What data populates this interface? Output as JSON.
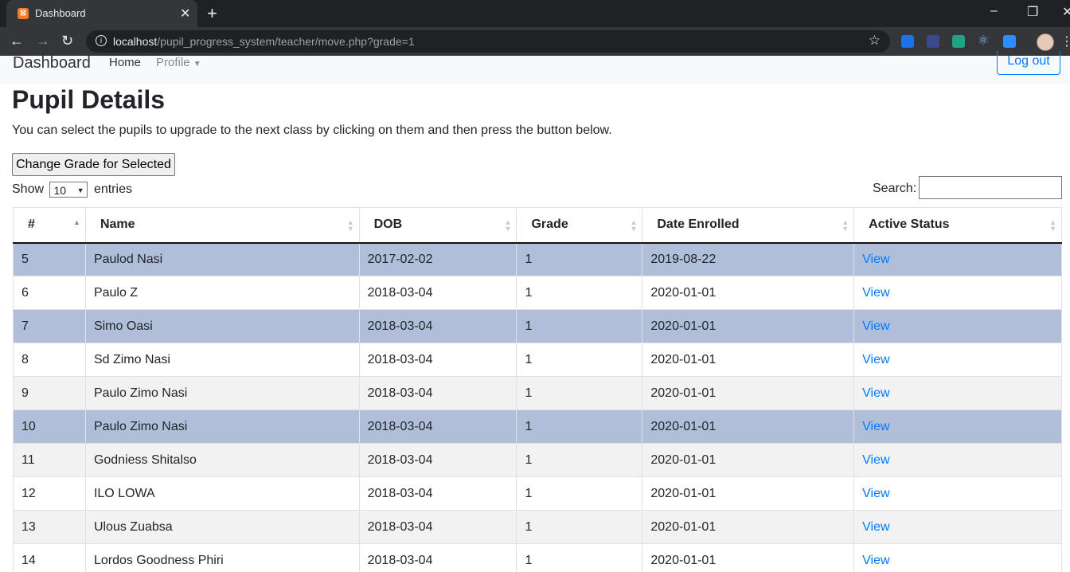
{
  "browser": {
    "tab_title": "Dashboard",
    "tab_favicon": "⊠",
    "url_host": "localhost",
    "url_path": "/pupil_progress_system/teacher/move.php?grade=1"
  },
  "navbar": {
    "brand": "Dashboard",
    "home": "Home",
    "profile": "Profile",
    "logout": "Log out"
  },
  "page": {
    "title": "Pupil Details",
    "intro": "You can select the pupils to upgrade to the next class by clicking on them and then press the button below.",
    "change_button": "Change Grade for Selected",
    "show_label": "Show",
    "show_value": "10",
    "entries_label": "entries",
    "search_label": "Search:"
  },
  "table": {
    "headers": [
      "#",
      "Name",
      "DOB",
      "Grade",
      "Date Enrolled",
      "Active Status"
    ],
    "rows": [
      {
        "id": "5",
        "name": "Paulod Nasi",
        "dob": "2017-02-02",
        "grade": "1",
        "enrolled": "2019-08-22",
        "status": "View"
      },
      {
        "id": "6",
        "name": "Paulo Z",
        "dob": "2018-03-04",
        "grade": "1",
        "enrolled": "2020-01-01",
        "status": "View"
      },
      {
        "id": "7",
        "name": "Simo Oasi",
        "dob": "2018-03-04",
        "grade": "1",
        "enrolled": "2020-01-01",
        "status": "View"
      },
      {
        "id": "8",
        "name": "Sd Zimo Nasi",
        "dob": "2018-03-04",
        "grade": "1",
        "enrolled": "2020-01-01",
        "status": "View"
      },
      {
        "id": "9",
        "name": "Paulo Zimo Nasi",
        "dob": "2018-03-04",
        "grade": "1",
        "enrolled": "2020-01-01",
        "status": "View"
      },
      {
        "id": "10",
        "name": "Paulo Zimo Nasi",
        "dob": "2018-03-04",
        "grade": "1",
        "enrolled": "2020-01-01",
        "status": "View"
      },
      {
        "id": "11",
        "name": "Godniess Shitalso",
        "dob": "2018-03-04",
        "grade": "1",
        "enrolled": "2020-01-01",
        "status": "View"
      },
      {
        "id": "12",
        "name": "ILO LOWA",
        "dob": "2018-03-04",
        "grade": "1",
        "enrolled": "2020-01-01",
        "status": "View"
      },
      {
        "id": "13",
        "name": "Ulous Zuabsa",
        "dob": "2018-03-04",
        "grade": "1",
        "enrolled": "2020-01-01",
        "status": "View"
      },
      {
        "id": "14",
        "name": "Lordos Goodness Phiri",
        "dob": "2018-03-04",
        "grade": "1",
        "enrolled": "2020-01-01",
        "status": "View"
      }
    ]
  },
  "colors": {
    "selected_row": "#b0bed9",
    "odd_row": "#f2f2f2",
    "link": "#007bff"
  }
}
